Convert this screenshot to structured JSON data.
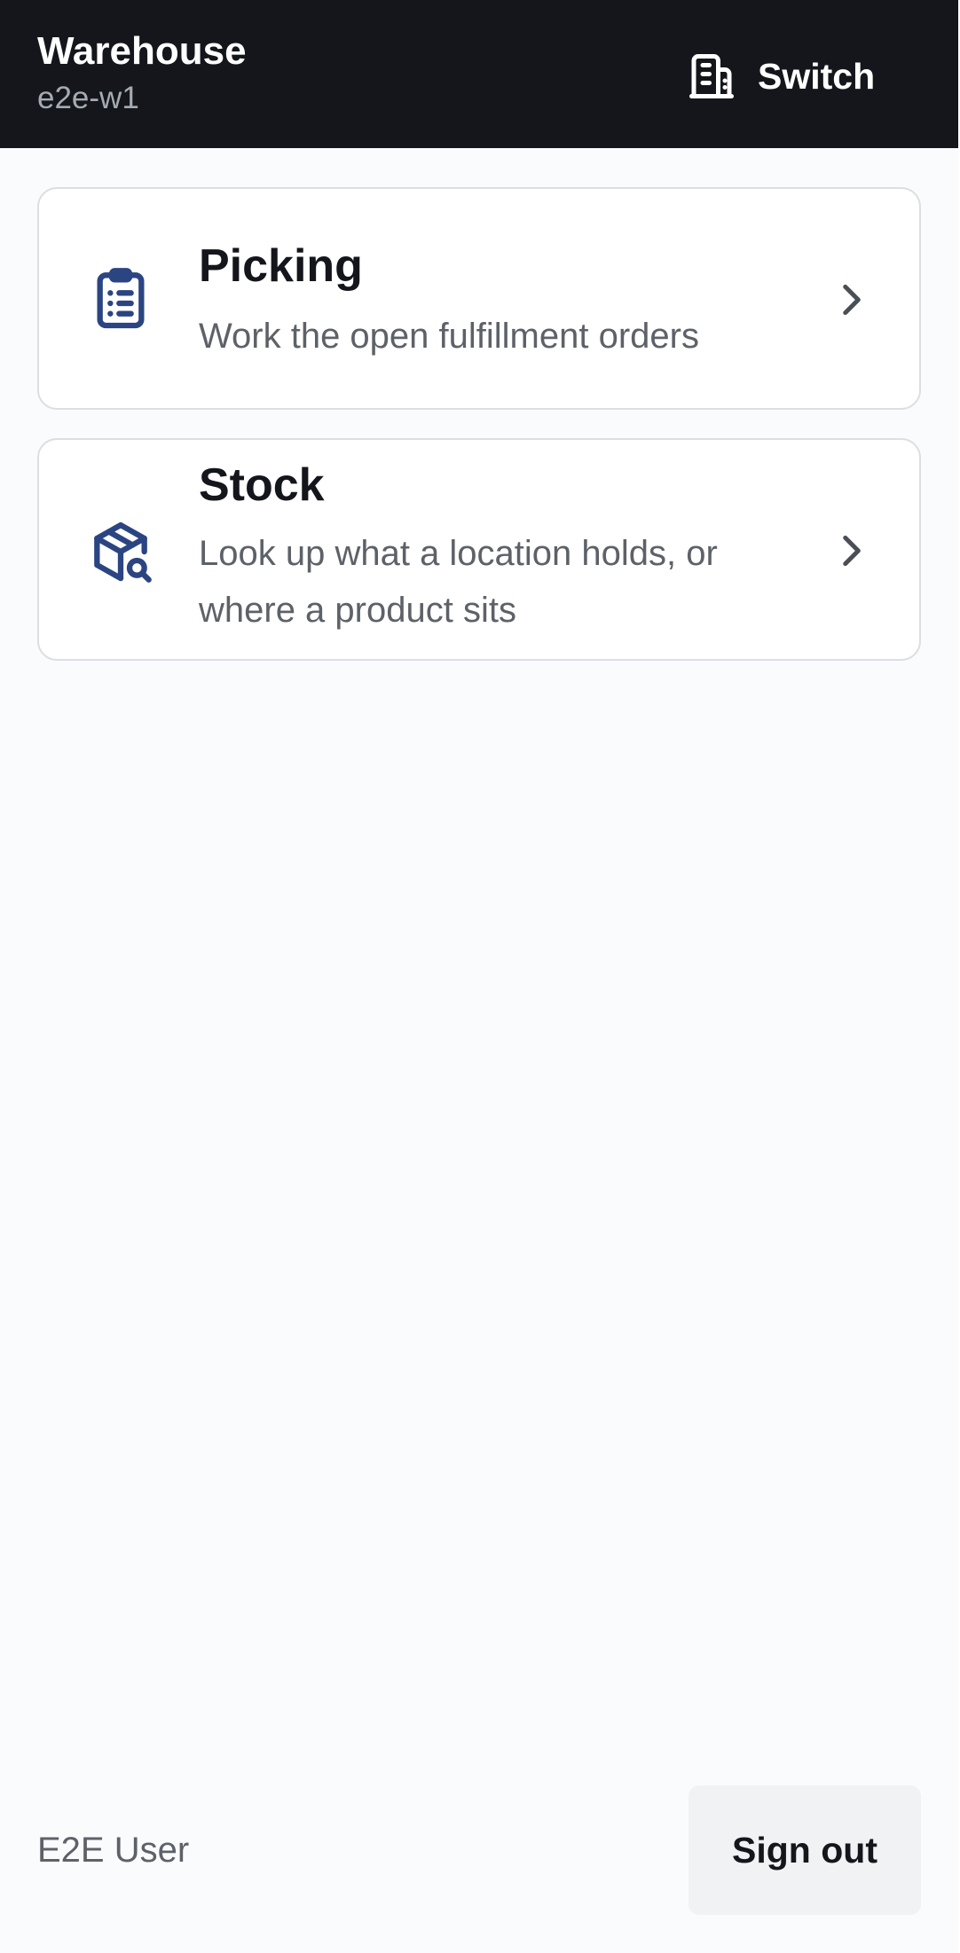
{
  "header": {
    "title": "Warehouse",
    "code": "e2e-w1",
    "switch_label": "Switch",
    "switch_icon": "building-icon"
  },
  "menu": {
    "items": [
      {
        "title": "Picking",
        "description": "Work the open fulfillment orders",
        "icon": "clipboard-list-icon"
      },
      {
        "title": "Stock",
        "description": "Look up what a location holds, or where a product sits",
        "icon": "package-search-icon"
      }
    ]
  },
  "footer": {
    "user": "E2E User",
    "signout_label": "Sign out"
  },
  "colors": {
    "header_bg": "#14161b",
    "accent_icon": "#2b4582",
    "page_bg": "#fafbfd"
  }
}
